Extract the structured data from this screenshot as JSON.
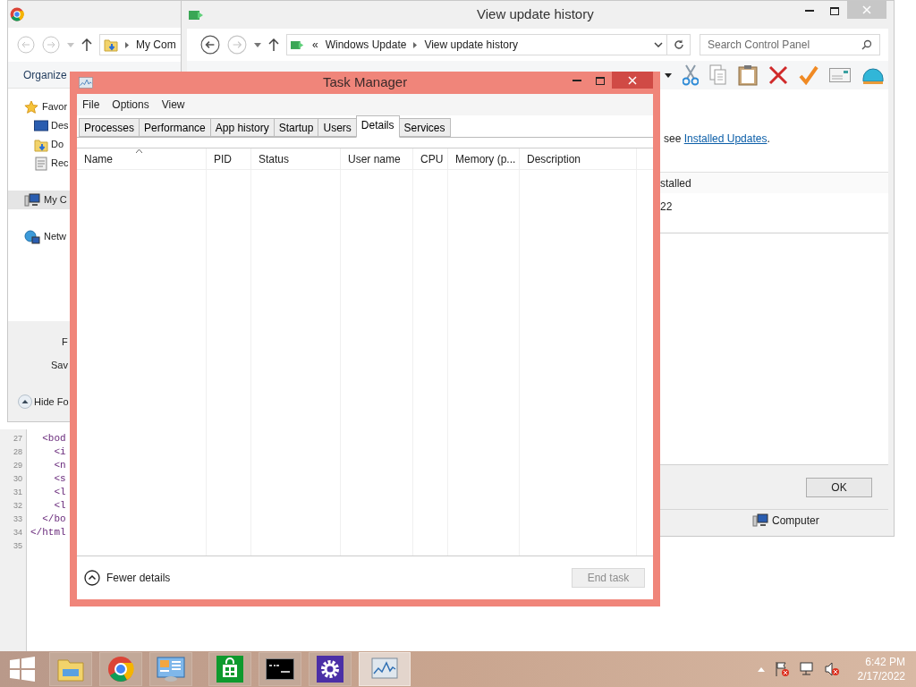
{
  "code_editor": {
    "lines": [
      {
        "number": "27",
        "code": "  <bod"
      },
      {
        "number": "28",
        "code": "    <i"
      },
      {
        "number": "29",
        "code": "    <n"
      },
      {
        "number": "30",
        "code": "    <s"
      },
      {
        "number": "31",
        "code": "    <l"
      },
      {
        "number": "32",
        "code": "    <l"
      },
      {
        "number": "33",
        "code": "  </bo"
      },
      {
        "number": "34",
        "code": "</html"
      },
      {
        "number": "35"
      }
    ]
  },
  "explorer_window": {
    "address": "My Com",
    "command": "Organize",
    "nav_items": [
      {
        "kind": "favorites",
        "label": "Favor",
        "selected": false,
        "children": [
          {
            "kind": "desktop",
            "label": "Des",
            "selected": false
          },
          {
            "kind": "downloads",
            "label": "Do",
            "selected": false
          },
          {
            "kind": "recent",
            "label": "Rec",
            "selected": false
          }
        ]
      },
      {
        "kind": "computer",
        "label": "My C",
        "selected": true
      },
      {
        "kind": "network",
        "label": "Netw",
        "selected": false
      }
    ],
    "detail_labels": [
      "F",
      "Sav"
    ],
    "hide_button": "Hide Fo"
  },
  "update_window": {
    "title": "View update history",
    "breadcrumb": [
      "«",
      "Windows Update",
      "View update history"
    ],
    "search": {
      "placeholder": "Search Control Panel"
    },
    "info": {
      "before": "see",
      "link": "Installed Updates",
      "after": "."
    },
    "column_header": "stalled",
    "cell": "22",
    "ok_button": "OK",
    "status": "Computer"
  },
  "task_manager": {
    "title": "Task Manager",
    "menu": [
      "File",
      "Options",
      "View"
    ],
    "tabs": [
      {
        "label": "Processes",
        "selected": false
      },
      {
        "label": "Performance",
        "selected": false
      },
      {
        "label": "App history",
        "selected": false
      },
      {
        "label": "Startup",
        "selected": false
      },
      {
        "label": "Users",
        "selected": false
      },
      {
        "label": "Details",
        "selected": true
      },
      {
        "label": "Services",
        "selected": false
      }
    ],
    "columns": [
      {
        "label": "Name",
        "sorted": true
      },
      {
        "label": "PID",
        "sorted": false
      },
      {
        "label": "Status",
        "sorted": false
      },
      {
        "label": "User name",
        "sorted": false
      },
      {
        "label": "CPU",
        "sorted": false
      },
      {
        "label": "Memory (p...",
        "sorted": false
      },
      {
        "label": "Description",
        "sorted": false
      }
    ],
    "fewer_details": "Fewer details",
    "end_task": {
      "label": "End task",
      "disabled": true
    }
  },
  "taskbar": {
    "apps": [
      {
        "kind": "explorer",
        "selected": false
      },
      {
        "kind": "browser",
        "selected": false
      },
      {
        "kind": "control-panel",
        "selected": false
      },
      {
        "kind": "store",
        "selected": false
      },
      {
        "kind": "terminal",
        "selected": false
      },
      {
        "kind": "settings",
        "selected": false
      },
      {
        "kind": "task-manager",
        "selected": true
      }
    ],
    "time": "6:42 PM",
    "date": "2/17/2022"
  }
}
